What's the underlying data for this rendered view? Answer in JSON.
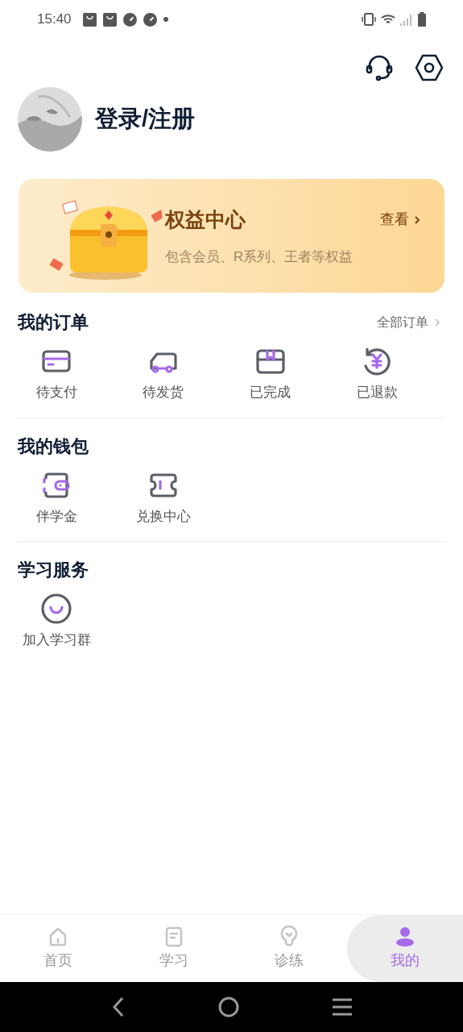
{
  "status_bar": {
    "time": "15:40"
  },
  "profile": {
    "login": "登录/注册"
  },
  "benefits": {
    "title": "权益中心",
    "subtitle": "包含会员、R系列、王者等权益",
    "link": "查看"
  },
  "sections": [
    {
      "title": "我的订单",
      "more": "全部订单",
      "items": [
        {
          "kind": "card",
          "label": "待支付"
        },
        {
          "kind": "truck",
          "label": "待发货"
        },
        {
          "kind": "box",
          "label": "已完成"
        },
        {
          "kind": "refund",
          "label": "已退款"
        }
      ]
    },
    {
      "title": "我的钱包",
      "items": [
        {
          "kind": "wallet",
          "label": "伴学金"
        },
        {
          "kind": "ticket",
          "label": "兑换中心"
        }
      ]
    },
    {
      "title": "学习服务",
      "items": [
        {
          "kind": "smile",
          "label": "加入学习群"
        }
      ]
    }
  ],
  "tabs": [
    {
      "kind": "home",
      "label": "首页",
      "selected": false
    },
    {
      "kind": "doc",
      "label": "学习",
      "selected": false
    },
    {
      "kind": "bulb",
      "label": "诊练",
      "selected": false
    },
    {
      "kind": "person",
      "label": "我的",
      "selected": true
    }
  ]
}
